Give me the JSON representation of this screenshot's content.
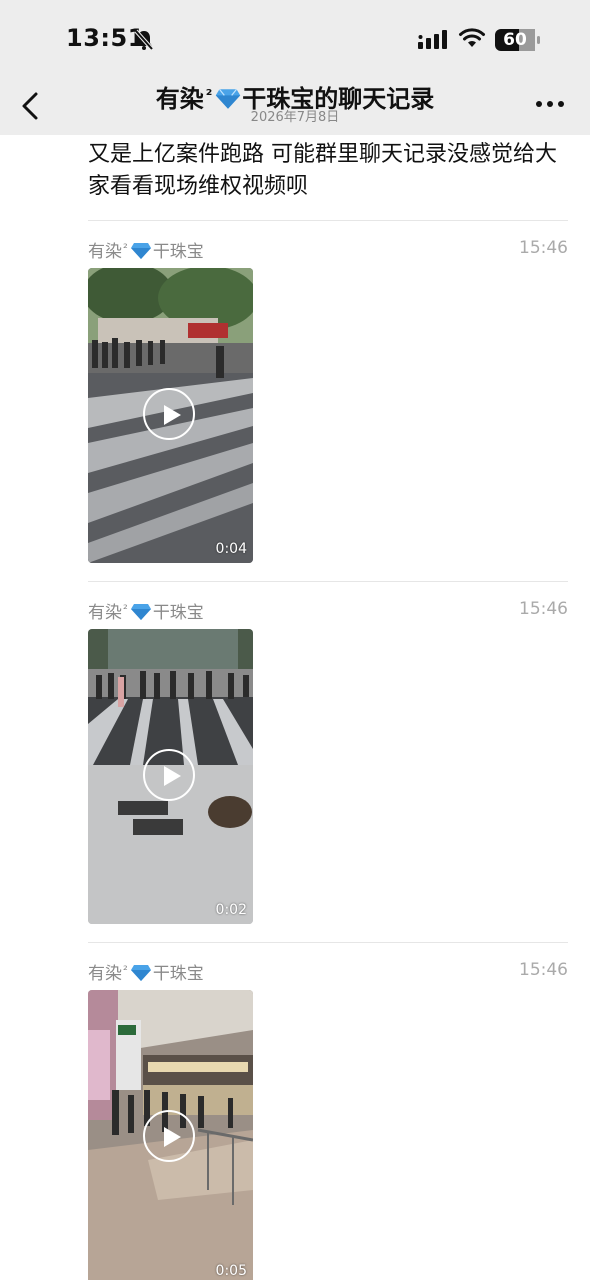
{
  "status_bar": {
    "time": "13:51",
    "battery": "60",
    "icons": [
      "bell-slash-icon",
      "signal-icon",
      "wifi-icon",
      "battery-icon"
    ]
  },
  "nav": {
    "title_prefix": "有染",
    "title_sup": "²",
    "title_suffix": "干珠宝的聊天记录",
    "subtitle": "2026年7月8日",
    "icons": [
      "chevron-left-icon",
      "more-icon"
    ]
  },
  "intro": {
    "text": "又是上亿案件跑路   可能群里聊天记录没感觉给大家看看现场维权视频呗"
  },
  "messages": [
    {
      "sender_prefix": "有染",
      "sender_sup": "²",
      "sender_suffix": "干珠宝",
      "time": "15:46",
      "duration": "0:04"
    },
    {
      "sender_prefix": "有染",
      "sender_sup": "²",
      "sender_suffix": "干珠宝",
      "time": "15:46",
      "duration": "0:02"
    },
    {
      "sender_prefix": "有染",
      "sender_sup": "²",
      "sender_suffix": "干珠宝",
      "time": "15:46",
      "duration": "0:05"
    }
  ],
  "colors": {
    "header_bg": "#ededed",
    "diamond": "#4aa3e8",
    "secondary_text": "#8a8a8a"
  }
}
